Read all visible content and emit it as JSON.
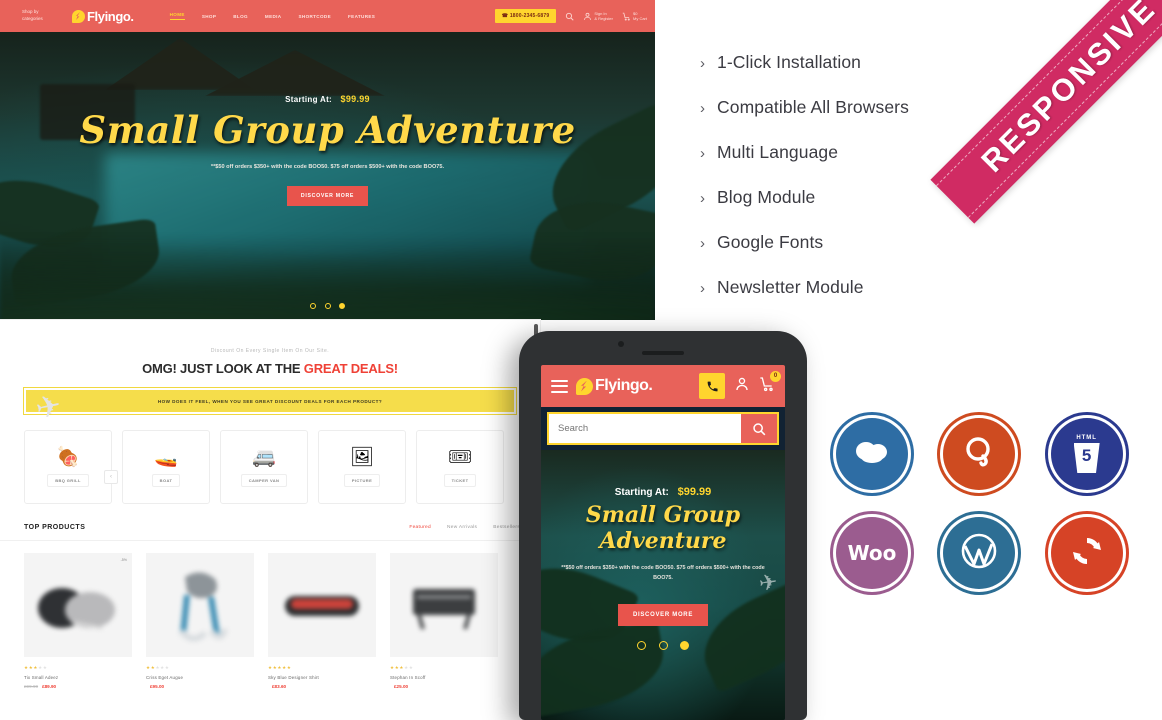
{
  "desktop": {
    "header": {
      "shop_by_categories": "Shop by categories",
      "logo_text": "Flyingo.",
      "nav": [
        {
          "label": "HOME",
          "active": true
        },
        {
          "label": "SHOP",
          "active": false
        },
        {
          "label": "BLOG",
          "active": false
        },
        {
          "label": "MEDIA",
          "active": false
        },
        {
          "label": "SHORTCODE",
          "active": false
        },
        {
          "label": "FEATURES",
          "active": false
        }
      ],
      "phone": "1800-2345-6879",
      "search_icon": "search-icon",
      "account_line1": "Sign In",
      "account_line2": "& Register",
      "cart_line1": "$0",
      "cart_line2": "My Cart"
    },
    "hero": {
      "starting_label": "Starting At:",
      "starting_price": "$99.99",
      "title": "Small Group Adventure",
      "subtitle": "**$50 off orders $350+ with the code BOO50. $75 off orders $500+ with the code BOO75.",
      "button": "DISCOVER MORE",
      "dots": 3,
      "active_dot": 3
    }
  },
  "features": {
    "items": [
      "1-Click Installation",
      "Compatible All Browsers",
      "Multi Language",
      "Blog Module",
      "Google Fonts",
      "Newsletter Module"
    ],
    "chevron": "›"
  },
  "ribbon": {
    "text": "RESPONSIVE",
    "color": "#d02b63"
  },
  "shop": {
    "deal_kicker": "Discount On Every Single Item On Our Site.",
    "deal_title_plain": "OMG! JUST LOOK AT THE ",
    "deal_title_accent": "GREAT DEALS!",
    "deal_banner": "HOW DOES IT FEEL, WHEN YOU SEE GREAT DISCOUNT DEALS FOR EACH PRODUCT?",
    "prev_arrow": "‹",
    "categories": [
      {
        "name": "BBQ GRILL",
        "icon": "🍖"
      },
      {
        "name": "BOAT",
        "icon": "🚤"
      },
      {
        "name": "CAMPER VAN",
        "icon": "🚐"
      },
      {
        "name": "PICTURE",
        "icon": "🖼"
      },
      {
        "name": "TICKET",
        "icon": "🎟"
      }
    ],
    "top_products_title": "TOP PRODUCTS",
    "tabs": [
      {
        "label": "Featured",
        "active": true
      },
      {
        "label": "New Arrivals",
        "active": false
      },
      {
        "label": "Bestsellers",
        "active": false
      }
    ],
    "products": [
      {
        "name": "Tix Small Adeez",
        "stars": 3,
        "price": "£89.90",
        "old_price": "£99.90",
        "badge": "-5%"
      },
      {
        "name": "Criss Eget Augue",
        "stars": 2,
        "price": "£95.00",
        "old_price": "",
        "badge": ""
      },
      {
        "name": "Sky Blue Designer Shirt",
        "stars": 5,
        "price": "£83.60",
        "old_price": "",
        "badge": ""
      },
      {
        "name": "Stephan In Scoff",
        "stars": 3,
        "price": "£25.00",
        "old_price": "",
        "badge": ""
      }
    ]
  },
  "phone": {
    "logo_text": "Flyingo.",
    "menu_icon": "hamburger-icon",
    "call_icon": "phone-icon",
    "account_icon": "user-icon",
    "cart_icon": "cart-icon",
    "cart_count": "0",
    "search_placeholder": "Search",
    "search_icon": "search-icon",
    "hero": {
      "starting_label": "Starting At:",
      "starting_price": "$99.99",
      "title": "Small Group Adventure",
      "subtitle": "**$50 off orders $350+ with the code BOO50. $75 off orders $500+ with the code BOO75.",
      "button": "DISCOVER MORE",
      "dots": 3,
      "active_dot": 3
    }
  },
  "tech_badges": [
    {
      "name": "bootstrap",
      "label": "",
      "color": "#2e6da4"
    },
    {
      "name": "jquery",
      "label": "",
      "color": "#ce4b20"
    },
    {
      "name": "html5",
      "label": "HTML",
      "sublabel": "5",
      "color": "#2b3a8f"
    },
    {
      "name": "woocommerce",
      "label": "Woo",
      "color": "#9b5c8f"
    },
    {
      "name": "wordpress",
      "label": "",
      "color": "#2d6e94"
    },
    {
      "name": "updates",
      "label": "",
      "color": "#d64326"
    }
  ]
}
